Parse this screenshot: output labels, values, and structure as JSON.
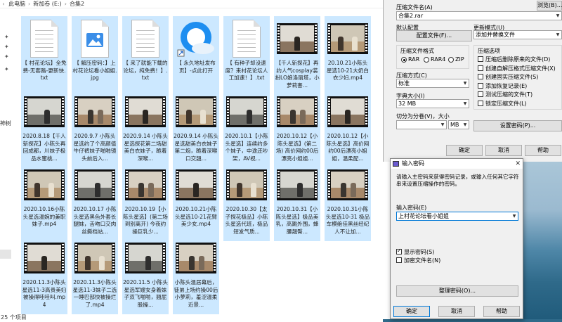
{
  "explorer": {
    "breadcrumb": [
      "此电脑",
      "新加卷 (E:)",
      "合集2"
    ],
    "nav_label": "神树",
    "status_text": "25 个项目",
    "files": [
      {
        "name": "【 村花论坛】全免费-无套路-更新快.txt",
        "type": "txt"
      },
      {
        "name": "【 解压密码：】上村花论坛看小姐姐.jpg",
        "type": "jpg"
      },
      {
        "name": "【 来了就能下载的论坛，纯免费！】.txt",
        "type": "txt"
      },
      {
        "name": "【 永久地址发布页】-点此打开",
        "type": "url"
      },
      {
        "name": "【 有种子却没速度？来村花论坛人工加速！】.txt",
        "type": "txt"
      },
      {
        "name": "【千人斩探花】再约人气cosplay装扮LO娘洛丽塔，小萝莉害...",
        "type": "mp4"
      },
      {
        "name": "20.10.21小陈头星选10-21大奶白衣少妇.mp4",
        "type": "mp4"
      },
      {
        "name": "2020.8.18【千人斩探花】小陈头再回成都，川妹子极品水蜜桃...",
        "type": "mp4"
      },
      {
        "name": "2020.9.7 小陈头星选约了个高颜值牛仔裤妹子啪啪镜头前后入...",
        "type": "mp4"
      },
      {
        "name": "2020.9.14 小陈头星选探花第二场甜美白衣妹子，跪着深喉...",
        "type": "mp4"
      },
      {
        "name": "2020.9.14 小陈头星选甜美白衣妹子第二炮，跪着深喉口交翘...",
        "type": "mp4"
      },
      {
        "name": "2020.10.1【小陈头星选】连续约多个妹子，中途还吵架，AV视...",
        "type": "mp4"
      },
      {
        "name": "2020.10.12【小陈头星选】(第二场) 高价网约00后漂亮小姐姐...",
        "type": "mp4"
      },
      {
        "name": "2020.10.12【小陈头星选】高价网约00后漂亮小姐姐，温柔配...",
        "type": "mp4"
      },
      {
        "name": "2020.10.16小陈头星选温婉的兼职妹子.mp4",
        "type": "mp4"
      },
      {
        "name": "2020.10.17 小陈头星选黑色外套长腿妹，舌吻口交肉丝撕档站...",
        "type": "mp4"
      },
      {
        "name": "2020.10.19【小陈头星选】(第二场到别离开) 今夜约操巨乳少...",
        "type": "mp4"
      },
      {
        "name": "2020.10.21小陈头星选10-21花臂美少女.mp4",
        "type": "mp4"
      },
      {
        "name": "2020.10.30【太子探花极品】小陈头星选代班，极品短发气质...",
        "type": "mp4"
      },
      {
        "name": "2020.10.31【小陈头星选】极品美乳，高跳外围，蜂腰翘臀...",
        "type": "mp4"
      },
      {
        "name": "2020.10.31小陈头星选10-31 极品车模绝佳黑丝经纪人不让加...",
        "type": "mp4"
      },
      {
        "name": "2020.11.3小陈头星选11-3高贵美妇被操得哇哇叫.mp4",
        "type": "mp4"
      },
      {
        "name": "2020.11.3小陈头星选11-3妹子二选一睡巴部快被操烂了.mp4",
        "type": "mp4"
      },
      {
        "name": "2020.11.5 小陈头星选军嫂女身着妹子双飞啪啪，翘屁股操...",
        "type": "mp4"
      },
      {
        "name": "小陈头温居幕后，徒弟上场约操00后小萝莉，羞涩温柔近景...",
        "type": "mp4"
      }
    ]
  },
  "archive_dialog": {
    "filename_label": "压缩文件名(A)",
    "browse_button": "浏览(B)...",
    "filename_value": "合集2.rar",
    "profile_label": "默认配置",
    "profile_button": "配置文件(F)...",
    "update_label": "更新模式(U)",
    "update_value": "添加并替换文件",
    "format_label": "压缩文件格式",
    "formats": [
      "RAR",
      "RAR4",
      "ZIP"
    ],
    "format_selected": "RAR",
    "method_label": "压缩方式(C)",
    "method_value": "标准",
    "dict_label": "字典大小(I)",
    "dict_value": "32 MB",
    "split_label": "切分为分卷(V)，大小",
    "split_unit": "MB",
    "options_label": "压缩选项",
    "options": [
      {
        "label": "压缩后删除原来的文件(D)",
        "checked": false
      },
      {
        "label": "创建自解压格式压缩文件(X)",
        "checked": false
      },
      {
        "label": "创建固实压缩文件(S)",
        "checked": false
      },
      {
        "label": "添加恢复记录(E)",
        "checked": false
      },
      {
        "label": "测试压缩的文件(T)",
        "checked": false
      },
      {
        "label": "锁定压缩文件(L)",
        "checked": false
      }
    ],
    "set_password_button": "设置密码(P)...",
    "ok_button": "确定",
    "cancel_button": "取消",
    "help_button": "帮助"
  },
  "password_dialog": {
    "title": "输入密码",
    "instruction": "请输入主密码来获得密码记录，或输入任何其它字符串来设置压缩操作的密码。",
    "input_label": "输入密码(E)",
    "input_value": "上村花论坛看小姐姐",
    "show_password": {
      "label": "显示密码(S)",
      "checked": true
    },
    "encrypt_names": {
      "label": "加密文件名(N)",
      "checked": false
    },
    "organize_button": "整理密码(O)...",
    "ok_button": "确定",
    "cancel_button": "取消",
    "help_button": "帮助"
  },
  "colors": {
    "selection": "#cce8ff",
    "dialog_bg": "#f0f0f0",
    "accent": "#0078d7"
  }
}
